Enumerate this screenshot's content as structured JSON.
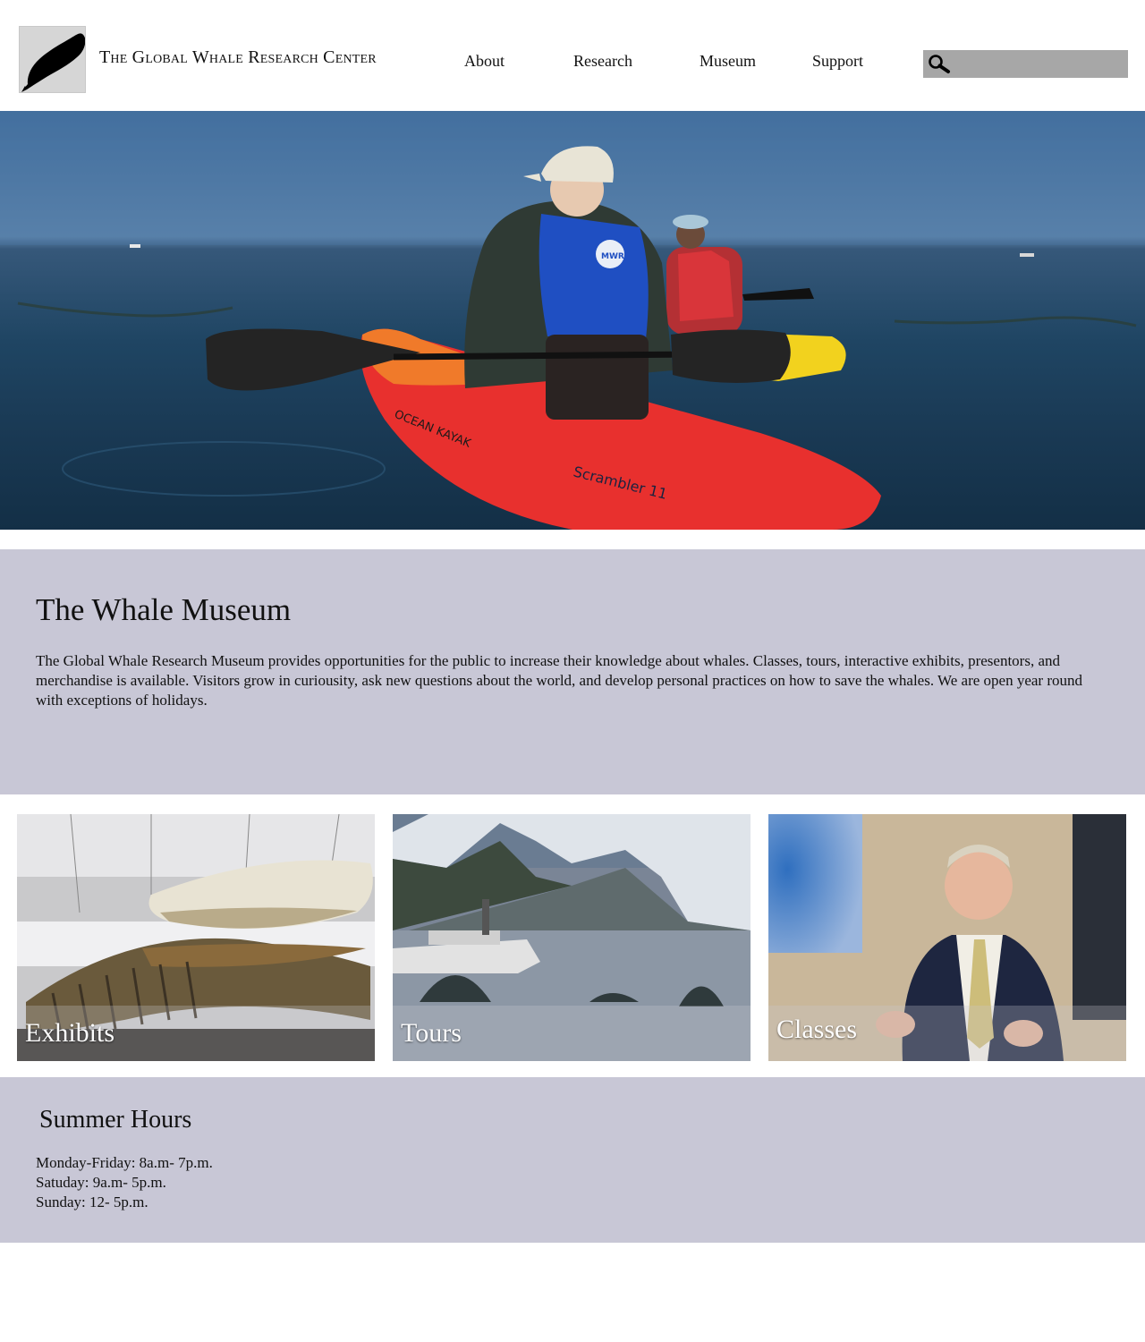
{
  "header": {
    "site_title": "The Global Whale Research Center",
    "nav": [
      "About",
      "Research",
      "Museum",
      "Support"
    ],
    "search": {
      "value": "",
      "placeholder": ""
    }
  },
  "hero": {
    "kayak_text": "Scrambler 11",
    "kayak_brand": "OCEAN KAYAK",
    "vest_text": "MWR"
  },
  "museum": {
    "title": "The Whale Museum",
    "description": "The Global Whale Research Museum provides opportunities for the public to increase their knowledge about whales. Classes, tours, interactive exhibits, presentors, and merchandise is available. Visitors grow in curiousity, ask new questions about the world, and develop personal practices on how to save the whales. We are open year round with exceptions of holidays."
  },
  "cards": [
    {
      "label": "Exhibits"
    },
    {
      "label": "Tours"
    },
    {
      "label": "Classes"
    }
  ],
  "hours": {
    "title": "Summer Hours",
    "lines": [
      "Monday-Friday: 8a.m- 7p.m.",
      "Satuday: 9a.m- 5p.m.",
      "Sunday: 12- 5p.m."
    ]
  },
  "colors": {
    "section_bg": "#c8c7d6",
    "search_bg": "#a7a7a7",
    "logo_bg": "#d6d6d6"
  }
}
